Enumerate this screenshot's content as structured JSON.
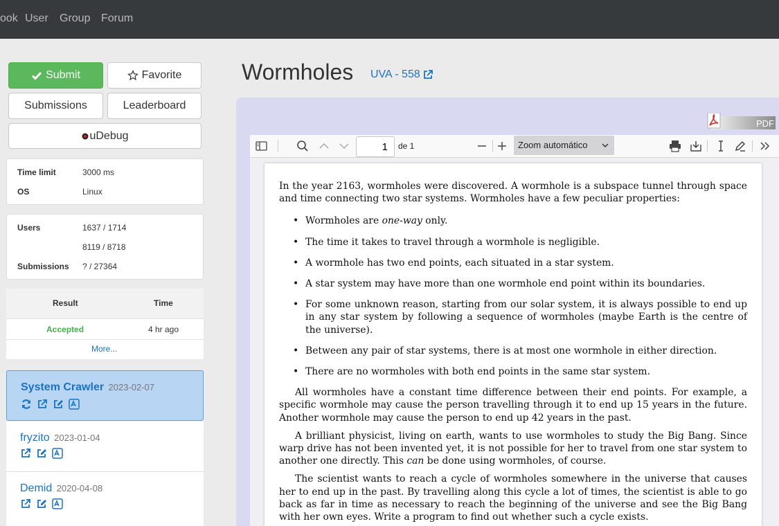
{
  "nav": {
    "items": [
      "ook",
      "User",
      "Group",
      "Forum"
    ]
  },
  "buttons": {
    "submit": "Submit",
    "favorite": "Favorite",
    "submissions": "Submissions",
    "leaderboard": "Leaderboard",
    "udebug": "uDebug"
  },
  "limits": {
    "time_limit_label": "Time limit",
    "time_limit_value": "3000 ms",
    "os_label": "OS",
    "os_value": "Linux"
  },
  "stats": {
    "users_label": "Users",
    "users_value": "1637 / 1714",
    "users_value2": "8119 / 8718",
    "submissions_label": "Submissions",
    "submissions_value": "? / 27364"
  },
  "results": {
    "col_result": "Result",
    "col_time": "Time",
    "rows": [
      {
        "result": "Accepted",
        "time": "4 hr ago"
      }
    ],
    "more": "More..."
  },
  "solutions": [
    {
      "name": "System Crawler",
      "date": "2023-02-07"
    },
    {
      "name": "fryzito",
      "date": "2023-01-04"
    },
    {
      "name": "Demid",
      "date": "2020-04-08"
    }
  ],
  "problem": {
    "title": "Wormholes",
    "source": "UVA - 558"
  },
  "pdf": {
    "badge": "PDF",
    "page": "1",
    "of": "de 1",
    "zoom": "Zoom automático"
  },
  "doc": {
    "intro": "In the year 2163, wormholes were discovered. A wormhole is a subspace tunnel through space and time connecting two star systems. Wormholes have a few peculiar properties:",
    "b1_pre": "Wormholes are ",
    "b1_em": "one-way",
    "b1_post": " only.",
    "b2": "The time it takes to travel through a wormhole is negligible.",
    "b3": "A wormhole has two end points, each situated in a star system.",
    "b4": "A star system may have more than one wormhole end point within its boundaries.",
    "b5": "For some unknown reason, starting from our solar system, it is always possible to end up in any star system by following a sequence of wormholes (maybe Earth is the centre of the universe).",
    "b6": "Between any pair of star systems, there is at most one wormhole in either direction.",
    "b7": "There are no wormholes with both end points in the same star system.",
    "p2": "All wormholes have a constant time difference between their end points. For example, a specific wormhole may cause the person travelling through it to end up 15 years in the future. Another wormhole may cause the person to end up 42 years in the past.",
    "p3_pre": "A brilliant physicist, living on earth, wants to use wormholes to study the Big Bang. Since warp drive has not been invented yet, it is not possible for her to travel from one star system to another one directly. This ",
    "p3_em": "can",
    "p3_post": " be done using wormholes, of course.",
    "p4": "The scientist wants to reach a cycle of wormholes somewhere in the universe that causes her to end up in the past. By travelling along this cycle a lot of times, the scientist is able to go back as far in time as necessary to reach the beginning of the universe and see the Big Bang with her own eyes. Write a program to find out whether such a cycle exists."
  }
}
